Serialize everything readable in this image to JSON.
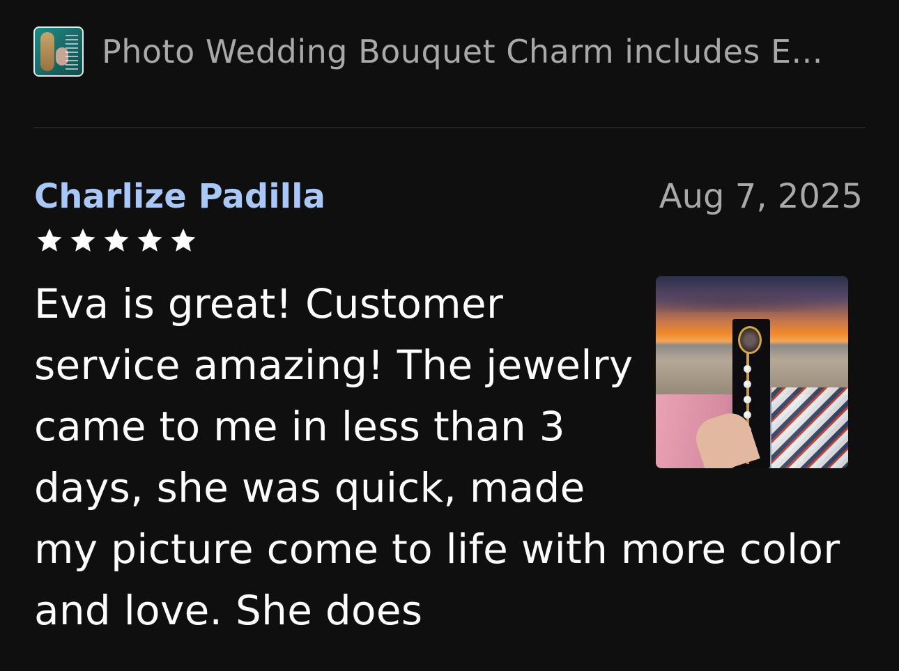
{
  "header": {
    "product_title": "Photo Wedding Bouquet Charm includes E...",
    "product_thumbnail_icon": "product-thumbnail"
  },
  "review": {
    "reviewer_name": "Charlize Padilla",
    "date": "Aug 7, 2025",
    "rating": 5,
    "rating_max": 5,
    "text": "Eva is great! Customer service amazing! The jewelry came to me in less than 3 days, she was quick, made my picture come to life with more color and love. She does",
    "photo_icon": "review-photo"
  },
  "colors": {
    "background": "#0f0f0f",
    "reviewer_name": "#a9c8f7",
    "muted_text": "#a9a9a9",
    "body_text": "#ffffff",
    "divider": "#3a3a3a"
  }
}
